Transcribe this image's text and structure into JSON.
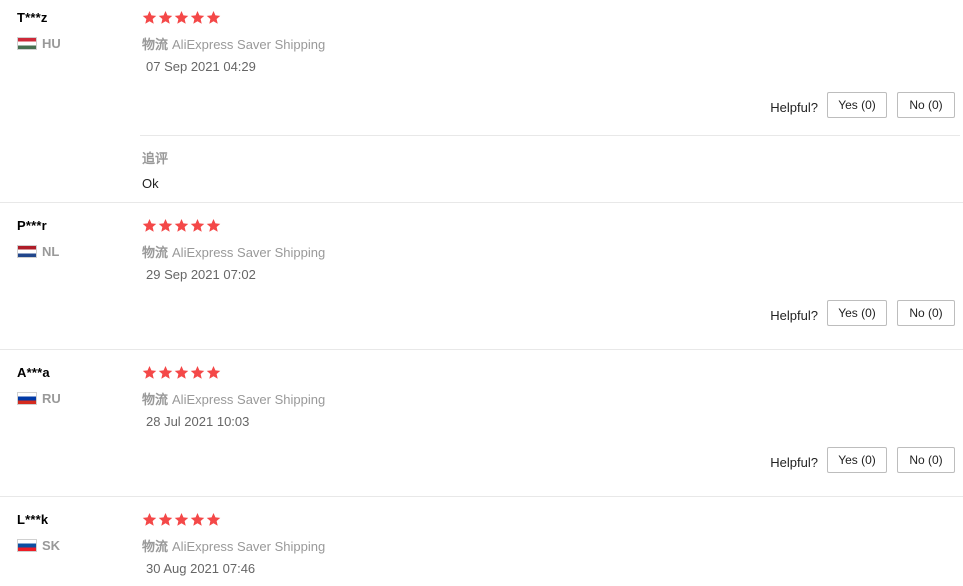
{
  "reviews": [
    {
      "user": "T***z",
      "country": "HU",
      "flag_colors": [
        "#ce2939",
        "#ffffff",
        "#477050"
      ],
      "rating": 5,
      "logistics_label": "物流",
      "logistics_value": "AliExpress Saver Shipping",
      "date": "07 Sep 2021 04:29",
      "helpful_label": "Helpful?",
      "yes_label": "Yes (0)",
      "no_label": "No (0)",
      "followup_title": "追评",
      "followup_text": "Ok"
    },
    {
      "user": "P***r",
      "country": "NL",
      "flag_colors": [
        "#ae1c28",
        "#ffffff",
        "#21468b"
      ],
      "rating": 5,
      "logistics_label": "物流",
      "logistics_value": "AliExpress Saver Shipping",
      "date": "29 Sep 2021 07:02",
      "helpful_label": "Helpful?",
      "yes_label": "Yes (0)",
      "no_label": "No (0)"
    },
    {
      "user": "A***a",
      "country": "RU",
      "flag_colors": [
        "#ffffff",
        "#0039a6",
        "#d52b1e"
      ],
      "rating": 5,
      "logistics_label": "物流",
      "logistics_value": "AliExpress Saver Shipping",
      "date": "28 Jul 2021 10:03",
      "helpful_label": "Helpful?",
      "yes_label": "Yes (0)",
      "no_label": "No (0)"
    },
    {
      "user": "L***k",
      "country": "SK",
      "flag_colors": [
        "#ffffff",
        "#0b4ea2",
        "#ee1c25"
      ],
      "rating": 5,
      "logistics_label": "物流",
      "logistics_value": "AliExpress Saver Shipping",
      "date": "30 Aug 2021 07:46"
    }
  ],
  "colors": {
    "star": "#f44848",
    "muted_text": "#999999",
    "divider": "#e8e8e8"
  }
}
